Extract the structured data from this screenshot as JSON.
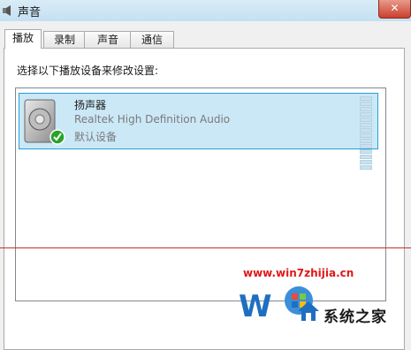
{
  "window": {
    "title": "声音",
    "close_label": "✕"
  },
  "tabs": [
    {
      "label": "播放",
      "active": true
    },
    {
      "label": "录制",
      "active": false
    },
    {
      "label": "声音",
      "active": false
    },
    {
      "label": "通信",
      "active": false
    }
  ],
  "main": {
    "instruction": "选择以下播放设备来修改设置:",
    "device": {
      "name": "扬声器",
      "driver": "Realtek High Definition Audio",
      "status": "默认设备"
    }
  },
  "watermark": {
    "url": "www.win7zhijia.cn",
    "site_name": "系统之家"
  },
  "colors": {
    "selection": "#cbe8f6",
    "selection_border": "#26a0da",
    "close_button": "#c9402c",
    "watermark": "#e01818"
  }
}
